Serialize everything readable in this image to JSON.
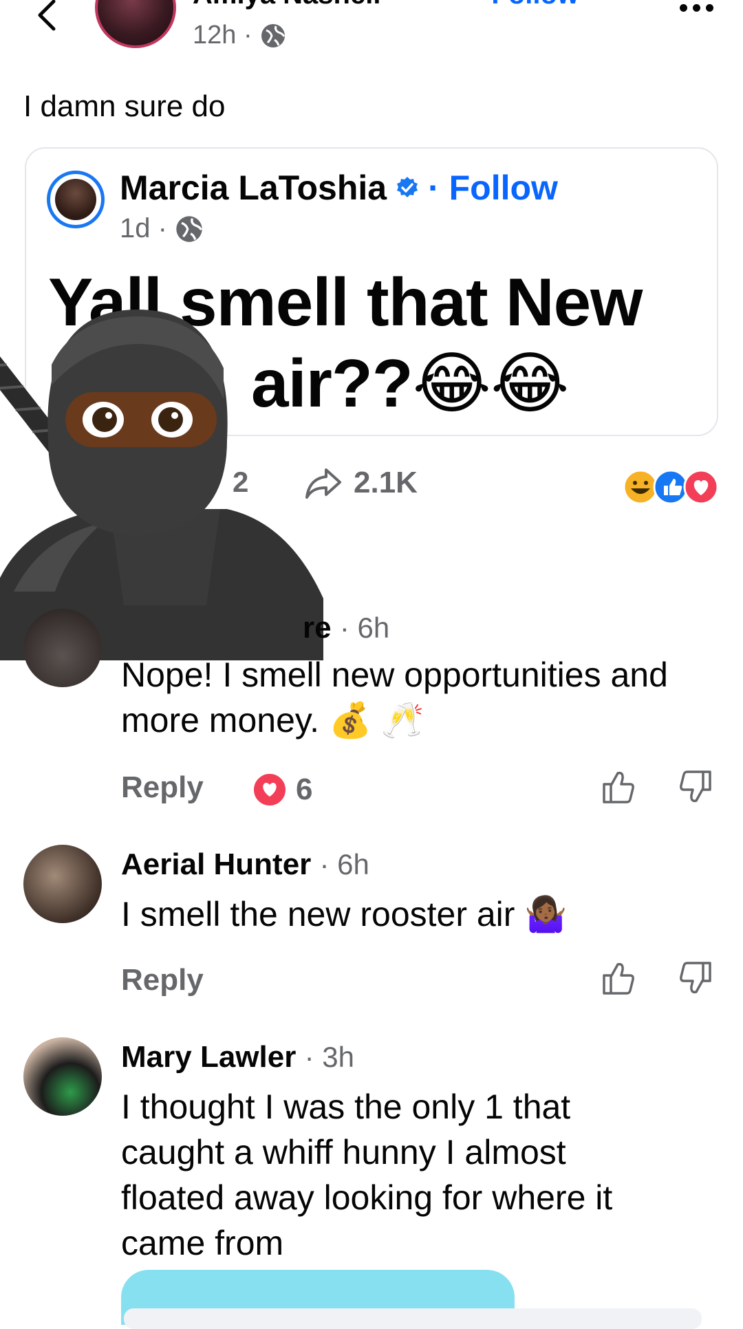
{
  "header": {
    "back_icon": "chevron-left-icon",
    "author_name": "Amiya Nashell",
    "follow_label": "· Follow",
    "time": "12h ·",
    "privacy_icon": "globe-icon",
    "more_icon": "more-dots-icon"
  },
  "post": {
    "text": "I damn sure do"
  },
  "shared_post": {
    "author_name": "Marcia LaToshia",
    "verified_icon": "verified-badge-icon",
    "follow_label": "· Follow",
    "time": "1d ·",
    "privacy_icon": "globe-icon",
    "text_line1": "Yall smell that New",
    "text_line2": "air??😂😂"
  },
  "stats": {
    "comments_partial": "2",
    "shares": "2.1K",
    "share_icon": "share-arrow-icon",
    "reactions": [
      "haha",
      "like",
      "love"
    ]
  },
  "overlay": {
    "icon": "ninja-emoji-icon"
  },
  "comments": [
    {
      "author_partial": "re",
      "time": "· 6h",
      "line1": "Nope! I smell new opportunities and",
      "line2": "more money. 💰 🥂",
      "reply_label": "Reply",
      "reaction_count": "6",
      "reaction_type": "love"
    },
    {
      "author": "Aerial Hunter",
      "time": "· 6h",
      "line1": "I smell the new rooster air 🤷🏾‍♀️",
      "reply_label": "Reply"
    },
    {
      "author": "Mary Lawler",
      "time": "· 3h",
      "line1": "I thought I was the only 1 that",
      "line2": "caught a whiff hunny I almost",
      "line3": "floated away looking for where it",
      "line4": "came from"
    }
  ],
  "colors": {
    "accent_blue": "#0866ff",
    "muted_text": "#65676b",
    "love_red": "#f33e58",
    "haha_yellow": "#f7b125"
  }
}
